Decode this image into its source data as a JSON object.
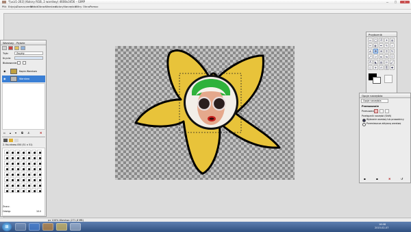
{
  "window": {
    "title": "*[ucz1-263] (Kolory RGB, 2 warstwy) 4608x3456 – GIMP",
    "minimize": "—",
    "maximize": "□",
    "close": "✕"
  },
  "menubar": [
    "Plik",
    "Edycja",
    "Zaznaczenie",
    "Widok",
    "Obraz",
    "Warstwa",
    "Kolory",
    "Narzędzia",
    "Filtry",
    "Okna",
    "Pomoc"
  ],
  "layers_panel": {
    "title": "Warstwy - Pędzle",
    "mode_label": "Tryb:",
    "mode_value": "Zwykły",
    "opacity_label": "Krycie:",
    "lock_label": "Blokowanie:",
    "layers": [
      {
        "name": "Kopia Warstwa",
        "selected": false
      },
      {
        "name": "Warstwa",
        "selected": true
      }
    ],
    "brush_name": "2. Ha-rdness 050 (51 × 51)",
    "brush_tag_label": "Znacz.",
    "spacing_label": "Odstęp",
    "spacing_value": "10.0"
  },
  "toolbox": {
    "title": "Przybornik",
    "tools": [
      "rect-select",
      "ellipse-select",
      "free-select",
      "fuzzy-select",
      "color-select",
      "scissors",
      "foreground-select",
      "paths",
      "color-picker",
      "zoom",
      "measure",
      "move",
      "align",
      "crop",
      "rotate",
      "scale",
      "shear",
      "perspective",
      "flip",
      "cage",
      "text",
      "bucket-fill",
      "blend",
      "pencil",
      "paintbrush",
      "eraser",
      "airbrush",
      "ink",
      "clone",
      "heal"
    ]
  },
  "tool_options": {
    "title": "Opcje narzędzia",
    "tab_label": "Opcje narzędzia",
    "heading": "Przesuwanie",
    "move_label": "Przesuwanie:",
    "toggle_label": "Przełącznik narzędzi (Shift)",
    "radio1": "Wybranie warstwy lub prowadnicy",
    "radio2": "Przemieszcza aktywną warstwę"
  },
  "status": {
    "text": "px  100%  Warstwa (271,8 MB)"
  },
  "taskbar": {
    "start": "⊞",
    "time": "16:08",
    "date": "2015-02-07",
    "apps": [
      "explorer",
      "ie",
      "media",
      "folder",
      "gimp"
    ]
  },
  "colors": {
    "petal": "#e8c33a",
    "selection": "#3a7fd5",
    "taskbar": "#2f4f7f"
  }
}
